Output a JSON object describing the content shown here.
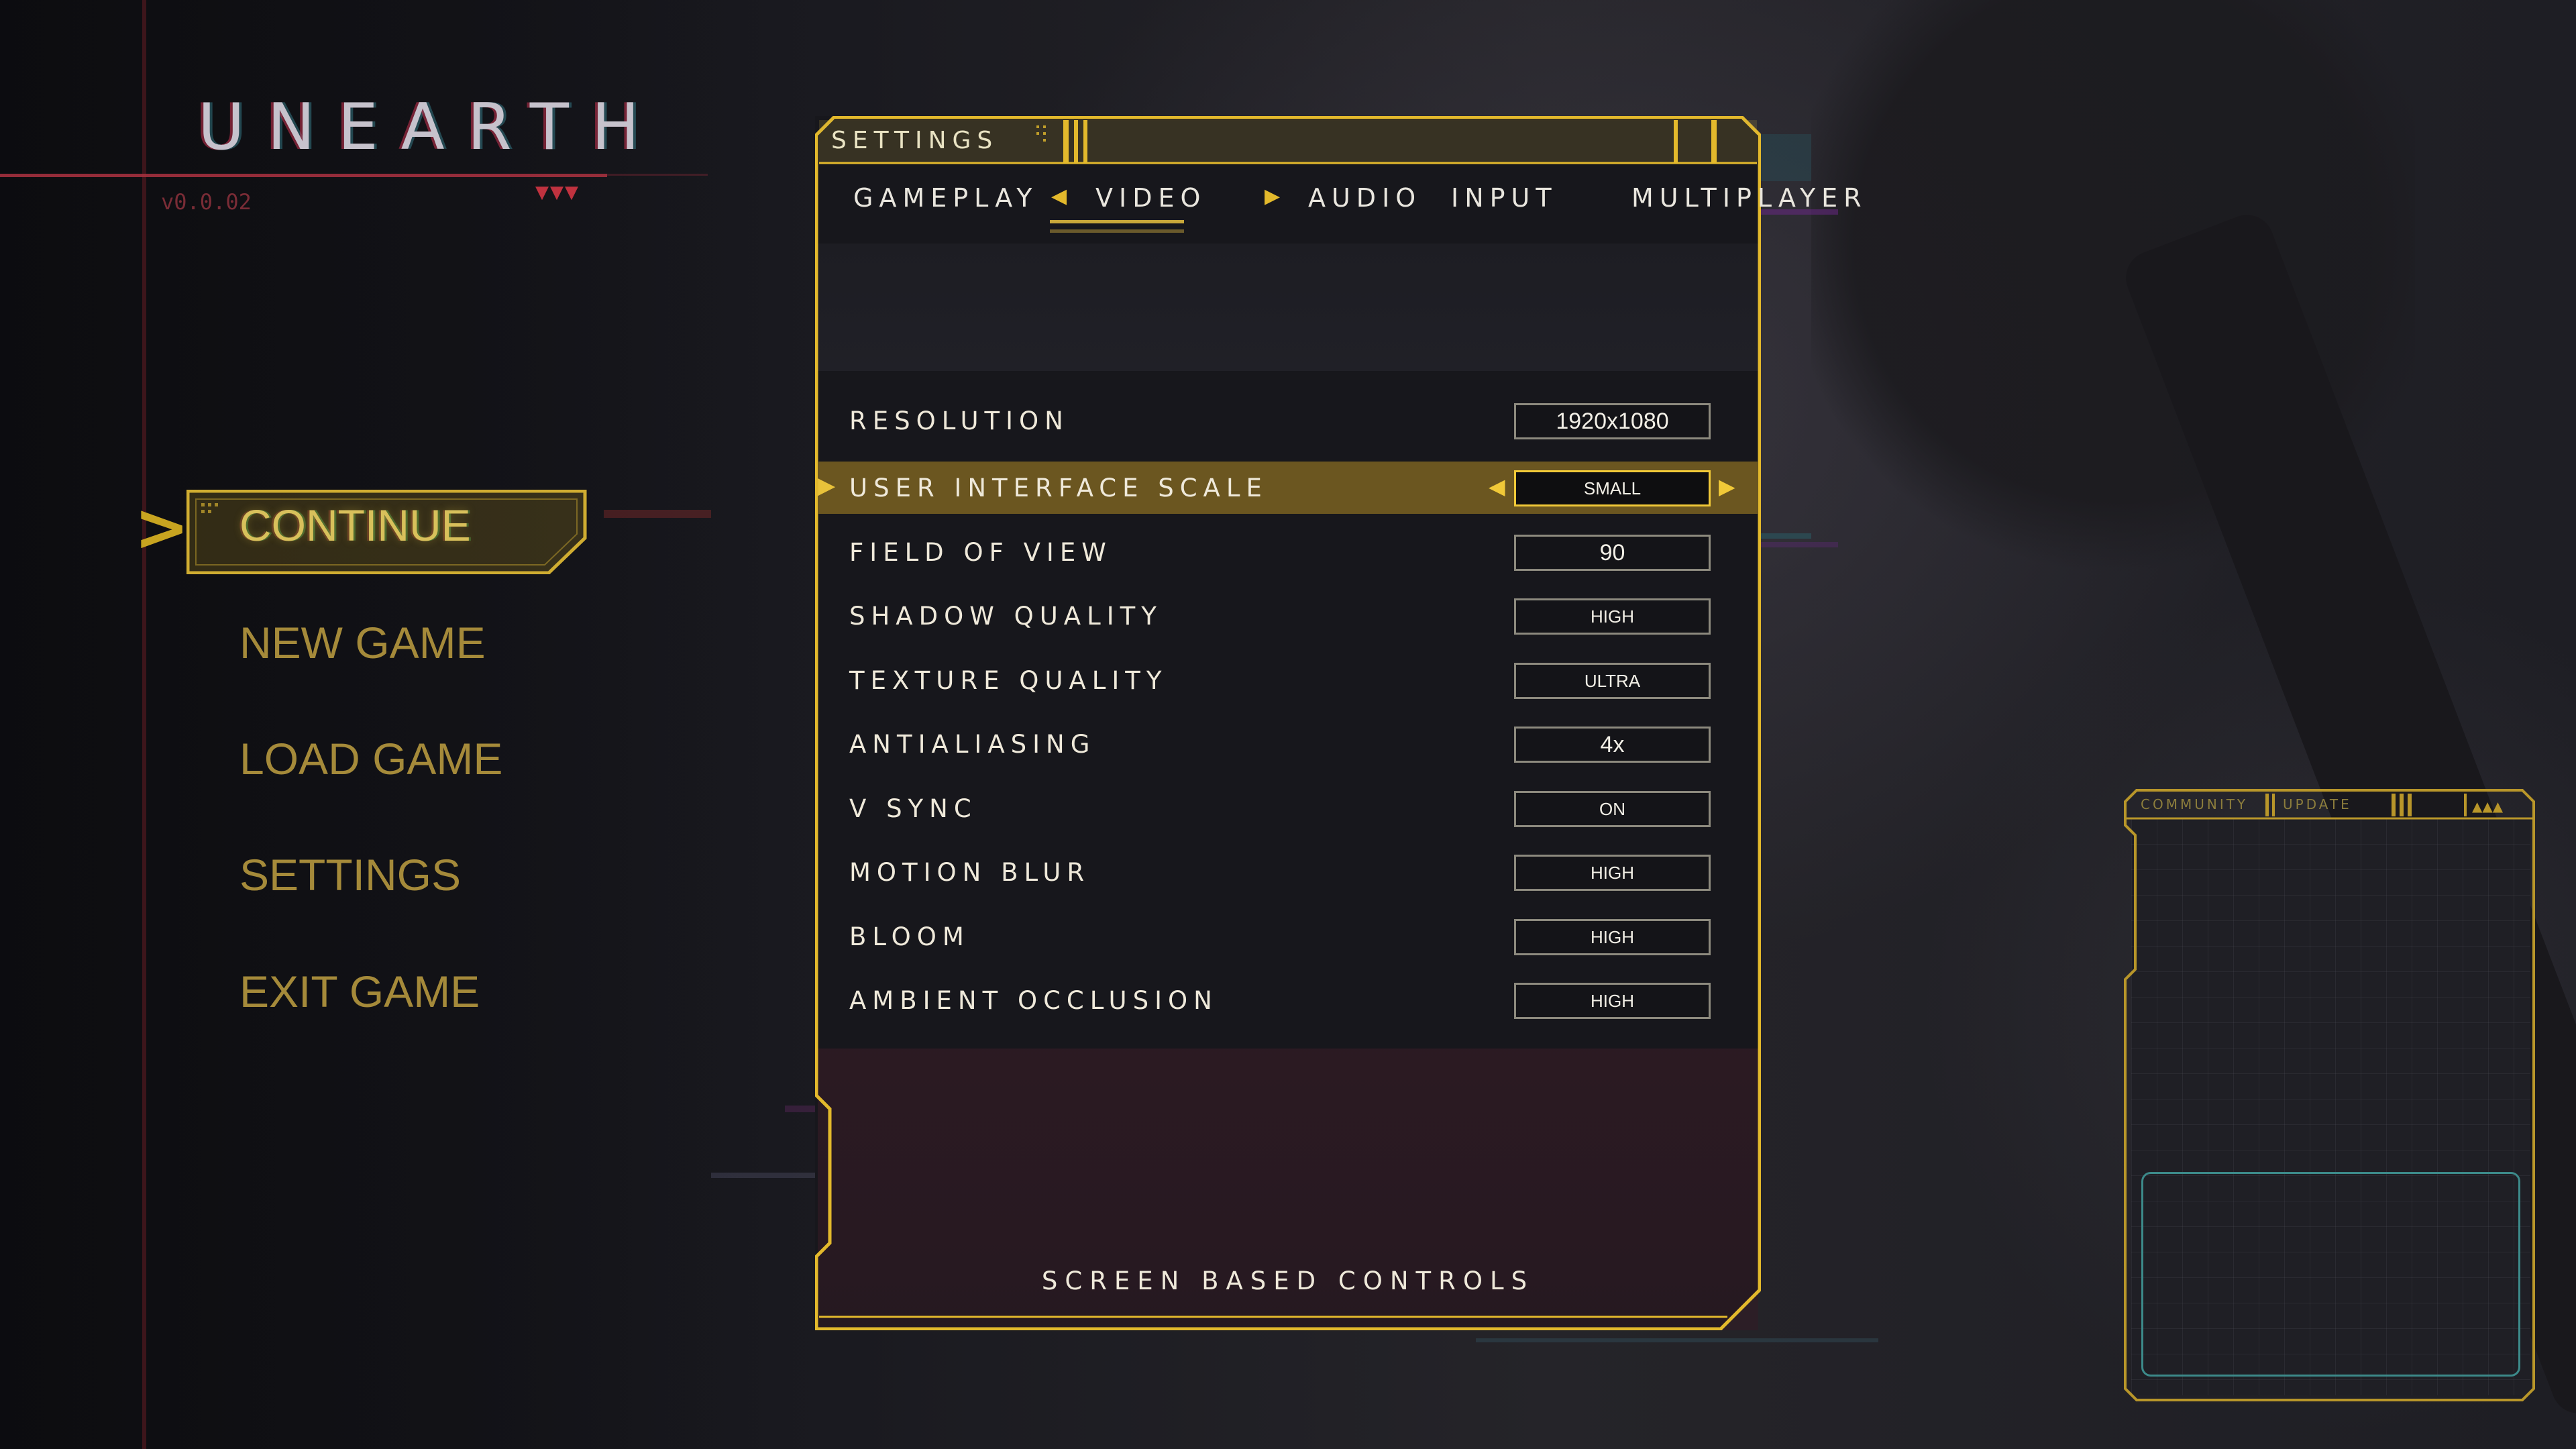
{
  "app": {
    "title": "UNEARTH",
    "version": "v0.0.02"
  },
  "main_menu": {
    "items": [
      {
        "label": "CONTINUE"
      },
      {
        "label": "NEW GAME"
      },
      {
        "label": "LOAD GAME"
      },
      {
        "label": "SETTINGS"
      },
      {
        "label": "EXIT GAME"
      }
    ],
    "selected_index": 0
  },
  "settings": {
    "title": "SETTINGS",
    "tabs": [
      {
        "label": "GAMEPLAY"
      },
      {
        "label": "VIDEO"
      },
      {
        "label": "AUDIO"
      },
      {
        "label": "INPUT"
      },
      {
        "label": "MULTIPLAYER"
      }
    ],
    "active_tab": "VIDEO",
    "rows": [
      {
        "label": "RESOLUTION",
        "value": "1920x1080"
      },
      {
        "label": "USER INTERFACE SCALE",
        "value": "SMALL"
      },
      {
        "label": "FIELD OF VIEW",
        "value": "90"
      },
      {
        "label": "SHADOW QUALITY",
        "value": "HIGH"
      },
      {
        "label": "TEXTURE QUALITY",
        "value": "ULTRA"
      },
      {
        "label": "ANTIALIASING",
        "value": "4x"
      },
      {
        "label": "V SYNC",
        "value": "ON"
      },
      {
        "label": "MOTION BLUR",
        "value": "HIGH"
      },
      {
        "label": "BLOOM",
        "value": "HIGH"
      },
      {
        "label": "AMBIENT OCCLUSION",
        "value": "HIGH"
      }
    ],
    "selected_row": "USER INTERFACE SCALE",
    "footer": "SCREEN BASED CONTROLS"
  },
  "community_card": {
    "tabs": [
      {
        "label": "COMMUNITY"
      },
      {
        "label": "UPDATE"
      }
    ]
  },
  "icons": {
    "menu_pointer": "chevron-right-icon",
    "tab_prev": "triangle-left-icon",
    "tab_next": "triangle-right-icon",
    "value_prev": "triangle-left-icon",
    "value_next": "triangle-right-icon",
    "row_marker": "triangle-right-icon"
  },
  "colors": {
    "accent": "#e3b92c",
    "accent_dim": "#a58a3a",
    "selected_row": "#6b5620",
    "logo_red": "#a3303e",
    "text": "#efe9da"
  }
}
